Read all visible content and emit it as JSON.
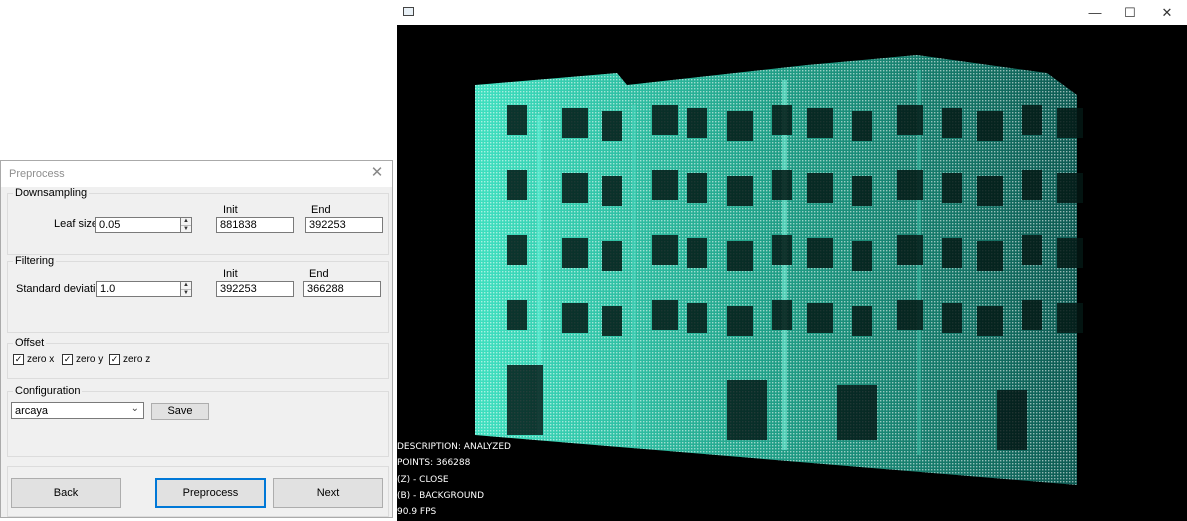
{
  "dialog": {
    "title": "Preprocess",
    "downsampling": {
      "group_label": "Downsampling",
      "leaf_size_label": "Leaf size",
      "leaf_size_value": "0.05",
      "init_label": "Init",
      "init_value": "881838",
      "end_label": "End",
      "end_value": "392253"
    },
    "filtering": {
      "group_label": "Filtering",
      "std_label": "Standard deviation",
      "std_value": "1.0",
      "init_label": "Init",
      "init_value": "392253",
      "end_label": "End",
      "end_value": "366288"
    },
    "offset": {
      "group_label": "Offset",
      "zero_x": "zero x",
      "zero_y": "zero y",
      "zero_z": "zero z"
    },
    "configuration": {
      "group_label": "Configuration",
      "selected": "arcaya",
      "save_label": "Save"
    },
    "buttons": {
      "back": "Back",
      "preprocess": "Preprocess",
      "next": "Next"
    }
  },
  "viewer": {
    "hud": {
      "description": "DESCRIPTION: ANALYZED",
      "points": "POINTS: 366288",
      "close": "(Z) - CLOSE",
      "background": "(B) - BACKGROUND",
      "fps": "90.9 FPS"
    },
    "point_color_light": "#3fe0c0",
    "point_color_dark": "#0d5a52"
  }
}
